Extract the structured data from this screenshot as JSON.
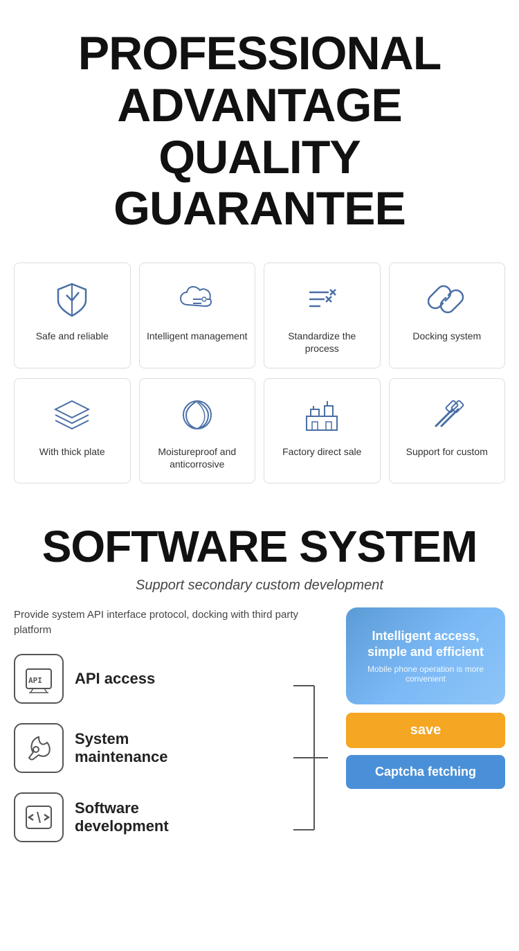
{
  "header": {
    "line1": "PROFESSIONAL",
    "line2": "ADVANTAGE",
    "line3": "QUALITY GUARANTEE"
  },
  "features_row1": [
    {
      "label": "Safe and reliable",
      "icon": "shield"
    },
    {
      "label": "Intelligent management",
      "icon": "cloud-settings"
    },
    {
      "label": "Standardize the process",
      "icon": "process"
    },
    {
      "label": "Docking system",
      "icon": "link"
    }
  ],
  "features_row2": [
    {
      "label": "With thick plate",
      "icon": "layers"
    },
    {
      "label": "Moistureproof and anticorrosive",
      "icon": "leaf"
    },
    {
      "label": "Factory direct sale",
      "icon": "factory"
    },
    {
      "label": "Support for custom",
      "icon": "tools"
    }
  ],
  "software": {
    "title": "SOFTWARE SYSTEM",
    "subtitle": "Support secondary custom development",
    "desc": "Provide system API interface protocol, docking with third party platform",
    "items": [
      {
        "label": "API access",
        "icon": "api"
      },
      {
        "label": "System\nmaintenance",
        "icon": "maintenance"
      },
      {
        "label": "Software\ndevelopment",
        "icon": "code"
      }
    ],
    "phone": {
      "title": "Intelligent access, simple and efficient",
      "subtitle": "Mobile phone operation is more convenient"
    },
    "btn_save": "save",
    "btn_captcha": "Captcha fetching"
  }
}
